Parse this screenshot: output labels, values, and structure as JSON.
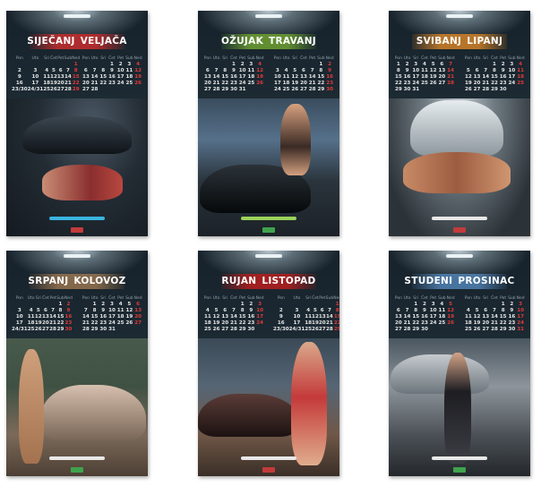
{
  "sheets": [
    {
      "months": [
        "SIJEČANJ",
        "VELJAČA"
      ],
      "weekday_row": [
        "Pon",
        "Uto",
        "Sri",
        "Čet",
        "Pet",
        "Sub",
        "Ned"
      ],
      "left_weeks": [
        [
          "",
          "",
          "",
          "",
          "",
          "",
          "1"
        ],
        [
          "2",
          "3",
          "4",
          "5",
          "6",
          "7",
          "8"
        ],
        [
          "9",
          "10",
          "11",
          "12",
          "13",
          "14",
          "15"
        ],
        [
          "16",
          "17",
          "18",
          "19",
          "20",
          "21",
          "22"
        ],
        [
          "23/30",
          "24/31",
          "25",
          "26",
          "27",
          "28",
          "29"
        ]
      ],
      "right_weeks": [
        [
          "",
          "",
          "",
          "1",
          "2",
          "3",
          "4"
        ],
        [
          "6",
          "7",
          "8",
          "9",
          "10",
          "11",
          "12"
        ],
        [
          "13",
          "14",
          "15",
          "16",
          "17",
          "18",
          "19"
        ],
        [
          "20",
          "21",
          "22",
          "23",
          "24",
          "25",
          "26"
        ],
        [
          "27",
          "28",
          "",
          "",
          "",
          "",
          ""
        ]
      ],
      "band_color": "red",
      "foot_color": "blue",
      "scene": "scene1"
    },
    {
      "months": [
        "OŽUJAK",
        "TRAVANJ"
      ],
      "weekday_row": [
        "Pon",
        "Uto",
        "Sri",
        "Čet",
        "Pet",
        "Sub",
        "Ned"
      ],
      "left_weeks": [
        [
          "",
          "",
          "",
          "1",
          "2",
          "3",
          "4"
        ],
        [
          "6",
          "7",
          "8",
          "9",
          "10",
          "11",
          "12"
        ],
        [
          "13",
          "14",
          "15",
          "16",
          "17",
          "18",
          "19"
        ],
        [
          "20",
          "21",
          "22",
          "23",
          "24",
          "25",
          "26"
        ],
        [
          "27",
          "28",
          "29",
          "30",
          "31",
          "",
          ""
        ]
      ],
      "right_weeks": [
        [
          "",
          "",
          "",
          "",
          "",
          "1",
          "2"
        ],
        [
          "3",
          "4",
          "5",
          "6",
          "7",
          "8",
          "9"
        ],
        [
          "10",
          "11",
          "12",
          "13",
          "14",
          "15",
          "16"
        ],
        [
          "17",
          "18",
          "19",
          "20",
          "21",
          "22",
          "23"
        ],
        [
          "24",
          "25",
          "26",
          "27",
          "28",
          "29",
          "30"
        ]
      ],
      "band_color": "green",
      "foot_color": "green",
      "scene": "scene2"
    },
    {
      "months": [
        "SVIBANJ",
        "LIPANJ"
      ],
      "weekday_row": [
        "Pon",
        "Uto",
        "Sri",
        "Čet",
        "Pet",
        "Sub",
        "Ned"
      ],
      "left_weeks": [
        [
          "1",
          "2",
          "3",
          "4",
          "5",
          "6",
          "7"
        ],
        [
          "8",
          "9",
          "10",
          "11",
          "12",
          "13",
          "14"
        ],
        [
          "15",
          "16",
          "17",
          "18",
          "19",
          "20",
          "21"
        ],
        [
          "22",
          "23",
          "24",
          "25",
          "26",
          "27",
          "28"
        ],
        [
          "29",
          "30",
          "31",
          "",
          "",
          "",
          ""
        ]
      ],
      "right_weeks": [
        [
          "",
          "",
          "",
          "1",
          "2",
          "3",
          "4"
        ],
        [
          "5",
          "6",
          "7",
          "8",
          "9",
          "10",
          "11"
        ],
        [
          "12",
          "13",
          "14",
          "15",
          "16",
          "17",
          "18"
        ],
        [
          "19",
          "20",
          "21",
          "22",
          "23",
          "24",
          "25"
        ],
        [
          "26",
          "27",
          "28",
          "29",
          "30",
          "",
          ""
        ]
      ],
      "band_color": "orange",
      "foot_color": "white",
      "scene": "scene3"
    },
    {
      "months": [
        "SRPANJ",
        "KOLOVOZ"
      ],
      "weekday_row": [
        "Pon",
        "Uto",
        "Sri",
        "Čet",
        "Pet",
        "Sub",
        "Ned"
      ],
      "left_weeks": [
        [
          "",
          "",
          "",
          "",
          "",
          "1",
          "2"
        ],
        [
          "3",
          "4",
          "5",
          "6",
          "7",
          "8",
          "9"
        ],
        [
          "10",
          "11",
          "12",
          "13",
          "14",
          "15",
          "16"
        ],
        [
          "17",
          "18",
          "19",
          "20",
          "21",
          "22",
          "23"
        ],
        [
          "24/31",
          "25",
          "26",
          "27",
          "28",
          "29",
          "30"
        ]
      ],
      "right_weeks": [
        [
          "",
          "1",
          "2",
          "3",
          "4",
          "5",
          "6"
        ],
        [
          "7",
          "8",
          "9",
          "10",
          "11",
          "12",
          "13"
        ],
        [
          "14",
          "15",
          "16",
          "17",
          "18",
          "19",
          "20"
        ],
        [
          "21",
          "22",
          "23",
          "24",
          "25",
          "26",
          "27"
        ],
        [
          "28",
          "29",
          "30",
          "31",
          "",
          "",
          ""
        ]
      ],
      "band_color": "brown",
      "foot_color": "white",
      "scene": "scene4"
    },
    {
      "months": [
        "RUJAN",
        "LISTOPAD"
      ],
      "weekday_row": [
        "Pon",
        "Uto",
        "Sri",
        "Čet",
        "Pet",
        "Sub",
        "Ned"
      ],
      "left_weeks": [
        [
          "",
          "",
          "",
          "",
          "1",
          "2",
          "3"
        ],
        [
          "4",
          "5",
          "6",
          "7",
          "8",
          "9",
          "10"
        ],
        [
          "11",
          "12",
          "13",
          "14",
          "15",
          "16",
          "17"
        ],
        [
          "18",
          "19",
          "20",
          "21",
          "22",
          "23",
          "24"
        ],
        [
          "25",
          "26",
          "27",
          "28",
          "29",
          "30",
          ""
        ]
      ],
      "right_weeks": [
        [
          "",
          "",
          "",
          "",
          "",
          "",
          "1"
        ],
        [
          "2",
          "3",
          "4",
          "5",
          "6",
          "7",
          "8"
        ],
        [
          "9",
          "10",
          "11",
          "12",
          "13",
          "14",
          "15"
        ],
        [
          "16",
          "17",
          "18",
          "19",
          "20",
          "21",
          "22"
        ],
        [
          "23/30",
          "24/31",
          "25",
          "26",
          "27",
          "28",
          "29"
        ]
      ],
      "band_color": "crimson",
      "foot_color": "white",
      "scene": "scene5"
    },
    {
      "months": [
        "STUDENI",
        "PROSINAC"
      ],
      "weekday_row": [
        "Pon",
        "Uto",
        "Sri",
        "Čet",
        "Pet",
        "Sub",
        "Ned"
      ],
      "left_weeks": [
        [
          "",
          "",
          "1",
          "2",
          "3",
          "4",
          "5"
        ],
        [
          "6",
          "7",
          "8",
          "9",
          "10",
          "11",
          "12"
        ],
        [
          "13",
          "14",
          "15",
          "16",
          "17",
          "18",
          "19"
        ],
        [
          "20",
          "21",
          "22",
          "23",
          "24",
          "25",
          "26"
        ],
        [
          "27",
          "28",
          "29",
          "30",
          "",
          "",
          ""
        ]
      ],
      "right_weeks": [
        [
          "",
          "",
          "",
          "",
          "1",
          "2",
          "3"
        ],
        [
          "4",
          "5",
          "6",
          "7",
          "8",
          "9",
          "10"
        ],
        [
          "11",
          "12",
          "13",
          "14",
          "15",
          "16",
          "17"
        ],
        [
          "18",
          "19",
          "20",
          "21",
          "22",
          "23",
          "24"
        ],
        [
          "25",
          "26",
          "27",
          "28",
          "29",
          "30",
          "31"
        ]
      ],
      "band_color": "blue",
      "foot_color": "white",
      "scene": "scene6"
    }
  ],
  "colors": {
    "sunday": "#e23a3a",
    "background": "#ffffff",
    "sheet": "#1c2a33"
  }
}
